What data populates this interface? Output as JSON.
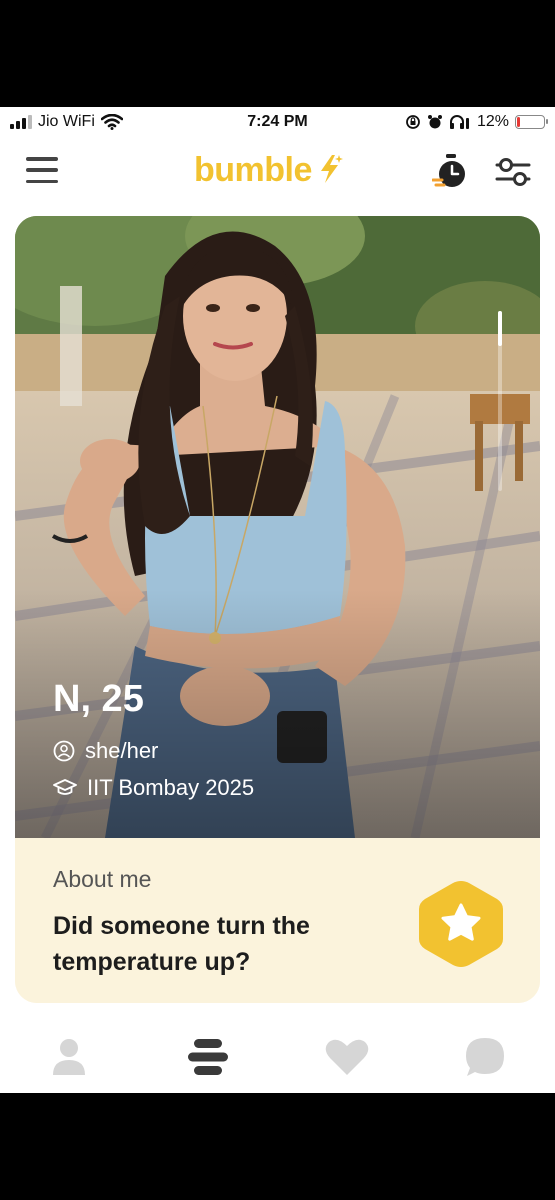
{
  "status_bar": {
    "carrier": "Jio WiFi",
    "time": "7:24 PM",
    "battery": "12%",
    "battery_level": 0.12
  },
  "header": {
    "logo_text": "bumble",
    "icons": [
      "menu-icon",
      "bolt-icon",
      "stopwatch-icon",
      "filter-icon"
    ]
  },
  "profile": {
    "name_age": "N, 25",
    "pronouns": "she/her",
    "education": "IIT Bombay 2025"
  },
  "about": {
    "title": "About me",
    "text": "Did someone turn the temperature up?"
  },
  "tabs": [
    "profile-tab",
    "discover-tab",
    "liked-you-tab",
    "chats-tab"
  ],
  "colors": {
    "brand_yellow": "#f2c230",
    "about_bg": "#fbf3dc",
    "tab_active": "#3a3a3a",
    "tab_inactive": "#d6d6d6"
  }
}
